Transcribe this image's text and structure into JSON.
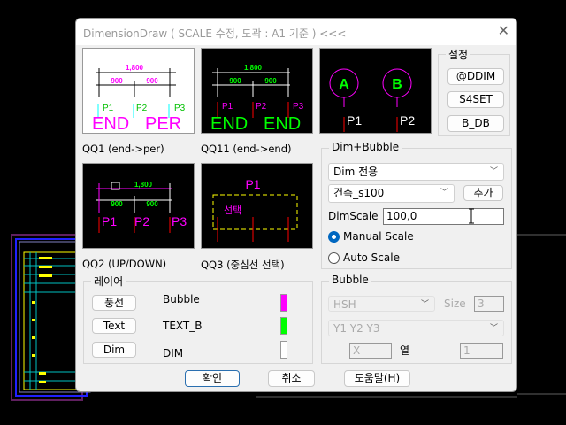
{
  "dialog": {
    "title": "DimensionDraw ( SCALE 수정,   도곽 : A1 기준 ) <<<",
    "close_label": "✕"
  },
  "previews": {
    "qq1": {
      "label": "QQ1 (end->per)",
      "dim_total": "1,800",
      "dim_a": "900",
      "dim_b": "900",
      "p1": "P1",
      "p2": "P2",
      "p3": "P3",
      "w1": "END",
      "w2": "PER"
    },
    "qq11": {
      "label": "QQ11 (end->end)",
      "dim_total": "1,800",
      "dim_a": "900",
      "dim_b": "900",
      "p1": "P1",
      "p2": "P2",
      "p3": "P3",
      "w1": "END",
      "w2": "END"
    },
    "bubble": {
      "a": "A",
      "b": "B",
      "p1": "P1",
      "p2": "P2"
    },
    "qq2": {
      "label": "QQ2 (UP/DOWN)",
      "dim_total": "1,800",
      "dim_a": "900",
      "dim_b": "900",
      "p1": "P1",
      "p2": "P2",
      "p3": "P3"
    },
    "qq3": {
      "label": "QQ3 (중심선 선택)",
      "p1": "P1",
      "sel": "선택"
    }
  },
  "settings": {
    "title": "설정",
    "buttons": [
      "@DDIM",
      "S4SET",
      "B_DB"
    ]
  },
  "dim_bubble": {
    "title": "Dim+Bubble",
    "mode": "Dim 전용",
    "style": "건축_s100",
    "add_label": "추가",
    "scale_label": "DimScale",
    "scale_value": "100,0",
    "manual_label": "Manual Scale",
    "auto_label": "Auto Scale",
    "manual_selected": true
  },
  "bubble": {
    "title": "Bubble",
    "name": "HSH",
    "size_label": "Size",
    "size_value": "3",
    "axis": "Y1 Y2 Y3",
    "x_value": "X",
    "col_label": "열",
    "col_value": "1"
  },
  "layer": {
    "title": "레이어",
    "rows": [
      {
        "button": "풍선",
        "name": "Bubble",
        "color": "#ff00ff"
      },
      {
        "button": "Text",
        "name": "TEXT_B",
        "color": "#00ff00"
      },
      {
        "button": "Dim",
        "name": "DIM",
        "color": "#ffffff"
      }
    ]
  },
  "footer": {
    "ok": "확인",
    "cancel": "취소",
    "help": "도움말(H)"
  },
  "colors": {
    "magenta": "#ff00ff",
    "green": "#00ff00",
    "red": "#ff0000",
    "yellow": "#ffff00",
    "cyan": "#00ffff"
  }
}
